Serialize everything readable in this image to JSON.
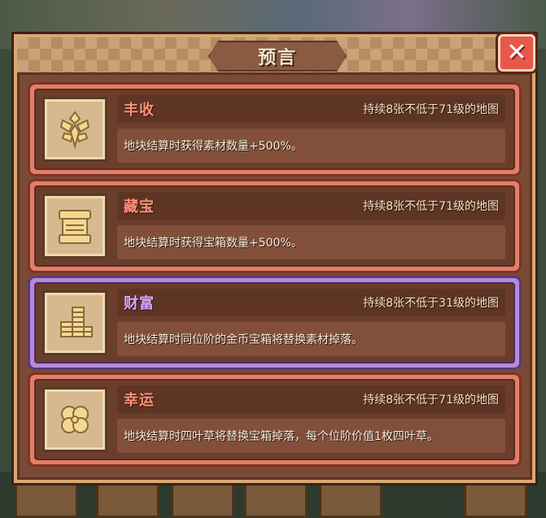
{
  "dialog": {
    "title": "预言",
    "close_label": "✕"
  },
  "prophecies": [
    {
      "name": "丰收",
      "condition": "持续8张不低于71级的地图",
      "description": "地块结算时获得素材数量+500%。",
      "icon": "wheat-icon",
      "rarity_color": "#e27e6a"
    },
    {
      "name": "藏宝",
      "condition": "持续8张不低于71级的地图",
      "description": "地块结算时获得宝箱数量+500%。",
      "icon": "scroll-icon",
      "rarity_color": "#e27e6a"
    },
    {
      "name": "财富",
      "condition": "持续8张不低于31级的地图",
      "description": "地块结算时同位阶的金币宝箱将替换素材掉落。",
      "icon": "gold-coins-icon",
      "rarity_color": "#b68ad8"
    },
    {
      "name": "幸运",
      "condition": "持续8张不低于71级的地图",
      "description": "地块结算时四叶草将替换宝箱掉落，每个位阶价值1枚四叶草。",
      "icon": "four-leaf-clover-icon",
      "rarity_color": "#e27e6a"
    }
  ],
  "background_tiles": [
    "6",
    "17",
    "33",
    "11",
    "11",
    "22"
  ]
}
